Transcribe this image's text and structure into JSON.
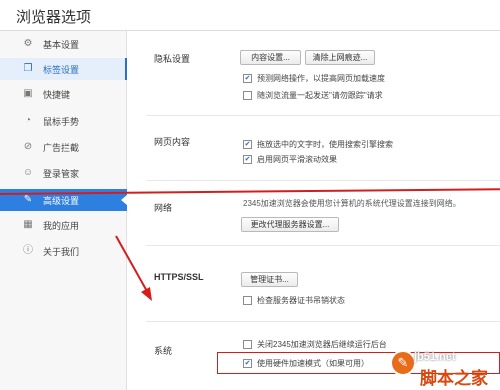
{
  "window": {
    "title": "浏览器选项"
  },
  "sidebar": {
    "items": [
      {
        "label": "基本设置",
        "icon": "gear-icon"
      },
      {
        "label": "标签设置",
        "icon": "tabs-icon"
      },
      {
        "label": "快捷键",
        "icon": "keyboard-icon"
      },
      {
        "label": "鼠标手势",
        "icon": "mouse-icon"
      },
      {
        "label": "广告拦截",
        "icon": "block-icon"
      },
      {
        "label": "登录管家",
        "icon": "user-icon"
      },
      {
        "label": "高级设置",
        "icon": "wrench-icon"
      },
      {
        "label": "我的应用",
        "icon": "apps-icon"
      },
      {
        "label": "关于我们",
        "icon": "info-icon"
      }
    ]
  },
  "privacy": {
    "label": "隐私设置",
    "content_settings_button": "内容设置...",
    "clear_data_button": "清除上网痕迹...",
    "predict_checkbox": "预测网络操作，以提高网页加载速度",
    "dnt_checkbox": "随浏览流量一起发送\"请勿跟踪\"请求"
  },
  "webcontent": {
    "label": "网页内容",
    "drag_search_checkbox": "拖放选中的文字时，使用搜索引擎搜索",
    "smooth_scroll_checkbox": "启用网页平滑滚动效果"
  },
  "network": {
    "label": "网络",
    "description": "2345加速浏览器会使用您计算机的系统代理设置连接到网络。",
    "proxy_button": "更改代理服务器设置..."
  },
  "https": {
    "label": "HTTPS/SSL",
    "manage_certs_button": "管理证书...",
    "revocation_checkbox": "检查服务器证书吊销状态"
  },
  "system": {
    "label": "系统",
    "background_checkbox": "关闭2345加速浏览器后继续运行后台",
    "hardware_accel_checkbox": "使用硬件加速模式（如果可用）"
  },
  "watermark": {
    "site": "jb51.net",
    "name": "脚本之家"
  },
  "colors": {
    "accent": "#2d7fe0",
    "annotation_red": "#d41e1e"
  }
}
